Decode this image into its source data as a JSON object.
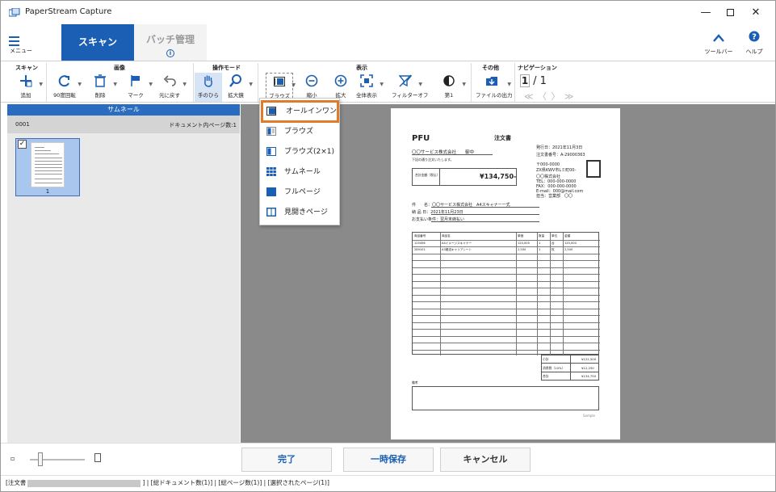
{
  "window": {
    "title": "PaperStream Capture"
  },
  "tabs": {
    "scan": "スキャン",
    "batch": "バッチ管理"
  },
  "menu": {
    "label": "メニュー"
  },
  "header_right": {
    "toolbar": "ツールバー",
    "help": "ヘルプ"
  },
  "ribbon": {
    "groups": {
      "scan": "スキャン",
      "image": "画像",
      "mode": "操作モード",
      "view": "表示",
      "other": "その他",
      "nav": "ナビゲーション"
    },
    "tools": {
      "add": "追加",
      "rotate": "90度回転",
      "delete": "削除",
      "mark": "マーク",
      "undo": "元に戻す",
      "hand": "手のひら",
      "zoom_in_mode": "拡大鏡",
      "browse": "ブラウズ",
      "shrink": "縮小",
      "enlarge": "拡大",
      "fit": "全体表示",
      "filter_off": "フィルターオフ",
      "stamp": "第1",
      "file_out": "ファイルの出力"
    },
    "page_current": "1",
    "page_total": "/ 1",
    "nav_arrows": "≪ 〈 〉 ≫"
  },
  "thumbnail_panel": {
    "header": "サムネール",
    "doc_id": "0001",
    "doc_count": "ドキュメント内ページ数:1",
    "page_no": "1"
  },
  "view_menu": {
    "items": [
      "オールインワン",
      "ブラウズ",
      "ブラウズ(2×1)",
      "サムネール",
      "フルページ",
      "見開きページ"
    ]
  },
  "document": {
    "company": "PFU",
    "title": "注文書",
    "issue_date": "発行日：2021年11月3日",
    "order_no": "注文書番号：A-29000363",
    "to": "〇〇サービス株式会社　　御中",
    "note": "下記の通り注文いたします。",
    "amount_label": "合計金額（税込）",
    "amount": "¥134,750-",
    "postal": "〒000-0000",
    "address": "ZX県KWV市Lミ町00-",
    "sender": "〇〇株式会社",
    "tel": "TEL：000-000-0000",
    "fax": "FAX：000-000-0000",
    "email": "E-mail：000@mail.com",
    "person": "担当：営業部　〇〇",
    "meta1": "件　　名：〇〇サービス株式会社　A4スキャナー一式",
    "meta2": "納 品 日：2021年11月23日",
    "meta3": "お支払い条件：翌月末締払い",
    "cols": [
      "商品番号",
      "商品名",
      "単価",
      "数量",
      "単位",
      "金額"
    ],
    "rows": [
      [
        "125456",
        "A4イメージスキャナー",
        "120,000",
        "1",
        "台",
        "120,000"
      ],
      [
        "289101",
        "A3搬送キャリアシート",
        "2,500",
        "1",
        "枚",
        "2,500"
      ]
    ],
    "subtotal_label": "小計",
    "subtotal": "¥122,500",
    "tax_label": "消費税（10%）",
    "tax": "¥12,250",
    "total_label": "合計",
    "total": "¥134,750",
    "remarks": "備考",
    "sample": "Sample"
  },
  "actions": {
    "done": "完了",
    "save": "一時保存",
    "cancel": "キャンセル"
  },
  "status": {
    "prefix": "[注文書",
    "suffix": "] | [総ドキュメント数(1)] | [総ページ数(1)] | [選択されたページ(1)]"
  },
  "colors": {
    "accent": "#1a5fb4",
    "highlight": "#e07b2a"
  }
}
